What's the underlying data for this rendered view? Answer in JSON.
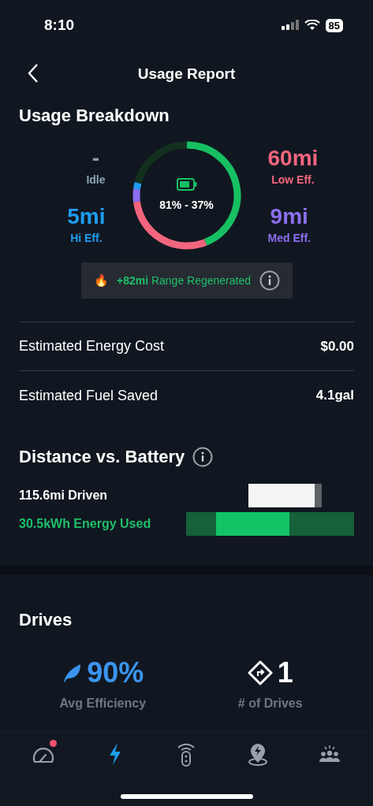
{
  "status_bar": {
    "time": "8:10",
    "battery": "85"
  },
  "header": {
    "title": "Usage Report"
  },
  "breakdown": {
    "title": "Usage Breakdown",
    "stats": [
      {
        "value": "-",
        "label": "Idle",
        "color": "#8aa4b2"
      },
      {
        "value": "60mi",
        "label": "Low Eff.",
        "color": "#f2657e"
      },
      {
        "value": "5mi",
        "label": "Hi Eff.",
        "color": "#1e9df0"
      },
      {
        "value": "9mi",
        "label": "Med Eff.",
        "color": "#8c6ff0"
      }
    ],
    "ring": {
      "reading": "81% - 37%",
      "segments": [
        {
          "color": "#16c062"
        },
        {
          "color": "#f2657e"
        },
        {
          "color": "#8c6ff0"
        },
        {
          "color": "#1e9df0"
        },
        {
          "color": "#13301f"
        }
      ]
    },
    "regen": {
      "icon": "🔥",
      "amount": "+82mi",
      "text": "Range Regenerated"
    }
  },
  "rows": [
    {
      "label": "Estimated Energy Cost",
      "value": "$0.00"
    },
    {
      "label": "Estimated Fuel Saved",
      "value": "4.1gal"
    }
  ],
  "distance": {
    "title": "Distance vs. Battery",
    "driven": {
      "label": "115.6mi Driven",
      "level": 0.9
    },
    "energy": {
      "label": "30.5kWh Energy Used",
      "level": 0.44
    }
  },
  "drives": {
    "title": "Drives",
    "stats": [
      {
        "kind": "efficiency",
        "value": "90%",
        "label": "Avg Efficiency"
      },
      {
        "kind": "count",
        "value": "1",
        "label": "# of Drives"
      }
    ]
  },
  "tabs": [
    {
      "kind": "gauge",
      "selected": false,
      "badge": true
    },
    {
      "kind": "bolt",
      "selected": true,
      "badge": false
    },
    {
      "kind": "remote",
      "selected": false,
      "badge": false
    },
    {
      "kind": "pin",
      "selected": false,
      "badge": false
    },
    {
      "kind": "people",
      "selected": false,
      "badge": false
    }
  ]
}
